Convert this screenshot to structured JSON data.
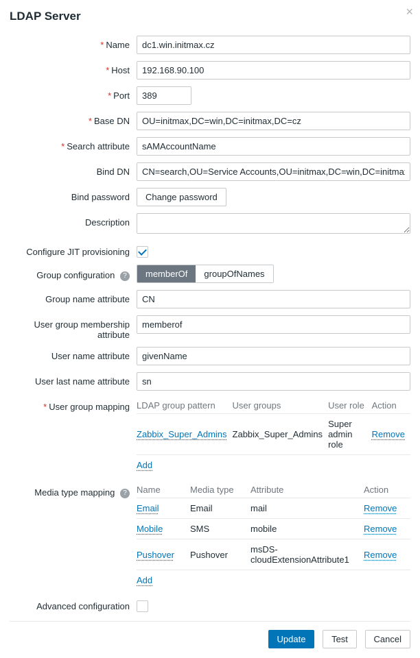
{
  "dialog_title": "LDAP Server",
  "labels": {
    "name": "Name",
    "host": "Host",
    "port": "Port",
    "base_dn": "Base DN",
    "search_attr": "Search attribute",
    "bind_dn": "Bind DN",
    "bind_password": "Bind password",
    "description": "Description",
    "jit": "Configure JIT provisioning",
    "group_config": "Group configuration",
    "group_name_attr": "Group name attribute",
    "user_group_membership_attr": "User group membership attribute",
    "user_name_attr": "User name attribute",
    "user_last_name_attr": "User last name attribute",
    "user_group_mapping": "User group mapping",
    "media_type_mapping": "Media type mapping",
    "advanced": "Advanced configuration"
  },
  "values": {
    "name": "dc1.win.initmax.cz",
    "host": "192.168.90.100",
    "port": "389",
    "base_dn": "OU=initmax,DC=win,DC=initmax,DC=cz",
    "search_attr": "sAMAccountName",
    "bind_dn": "CN=search,OU=Service Accounts,OU=initmax,DC=win,DC=initmax,DC=cz",
    "description": "",
    "jit_checked": true,
    "group_name_attr": "CN",
    "user_group_membership_attr": "memberof",
    "user_name_attr": "givenName",
    "user_last_name_attr": "sn",
    "advanced_checked": false
  },
  "group_config_options": {
    "opt1": "memberOf",
    "opt2": "groupOfNames",
    "active": "opt1"
  },
  "buttons": {
    "change_password": "Change password",
    "add": "Add",
    "remove": "Remove",
    "update": "Update",
    "test": "Test",
    "cancel": "Cancel"
  },
  "user_group_mapping": {
    "headers": {
      "pattern": "LDAP group pattern",
      "groups": "User groups",
      "role": "User role",
      "action": "Action"
    },
    "rows": [
      {
        "pattern": "Zabbix_Super_Admins",
        "groups": "Zabbix_Super_Admins",
        "role": "Super admin role"
      }
    ]
  },
  "media_type_mapping": {
    "headers": {
      "name": "Name",
      "type": "Media type",
      "attr": "Attribute",
      "action": "Action"
    },
    "rows": [
      {
        "name": "Email",
        "type": "Email",
        "attr": "mail"
      },
      {
        "name": "Mobile",
        "type": "SMS",
        "attr": "mobile"
      },
      {
        "name": "Pushover",
        "type": "Pushover",
        "attr": "msDS-cloudExtensionAttribute1"
      }
    ]
  }
}
